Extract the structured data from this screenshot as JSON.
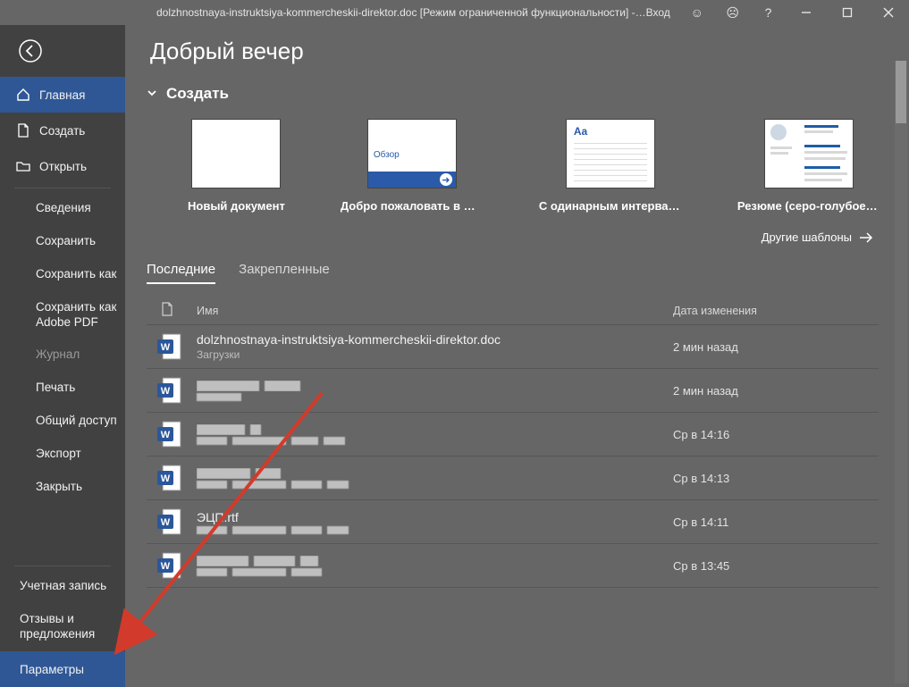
{
  "titlebar": {
    "title": "dolzhnostnaya-instruktsiya-kommercheskii-direktor.doc [Режим ограниченной функциональности]  -…",
    "sign_in": "Вход"
  },
  "sidebar": {
    "home": "Главная",
    "new": "Создать",
    "open": "Открыть",
    "subs": {
      "info": "Сведения",
      "save": "Сохранить",
      "save_as": "Сохранить как",
      "save_pdf": "Сохранить как Adobe PDF",
      "journal": "Журнал",
      "print": "Печать",
      "share": "Общий доступ",
      "export": "Экспорт",
      "close": "Закрыть"
    },
    "bottom": {
      "account": "Учетная запись",
      "feedback": "Отзывы и предложения",
      "options": "Параметры"
    }
  },
  "main": {
    "greeting": "Добрый вечер",
    "create": "Создать",
    "templates": [
      {
        "label": "Новый документ"
      },
      {
        "label": "Добро пожаловать в Word",
        "tour_text": "Обзор"
      },
      {
        "label": "С одинарным интервало…"
      },
      {
        "label": "Резюме (серо-голубое о…"
      }
    ],
    "more_templates": "Другие шаблоны",
    "tabs": {
      "recent": "Последние",
      "pinned": "Закрепленные"
    },
    "columns": {
      "name": "Имя",
      "date": "Дата изменения"
    },
    "docs": [
      {
        "name": "dolzhnostnaya-instruktsiya-kommercheskii-direktor.doc",
        "sub": "Загрузки",
        "date": "2 мин назад"
      },
      {
        "name": "",
        "sub": "",
        "date": "2 мин назад"
      },
      {
        "name": "",
        "sub": "",
        "date": "Ср в 14:16"
      },
      {
        "name": "",
        "sub": "",
        "date": "Ср в 14:13"
      },
      {
        "name": "ЭЦП.rtf",
        "sub": "",
        "date": "Ср в 14:11"
      },
      {
        "name": "",
        "sub": "",
        "date": "Ср в 13:45"
      }
    ]
  }
}
